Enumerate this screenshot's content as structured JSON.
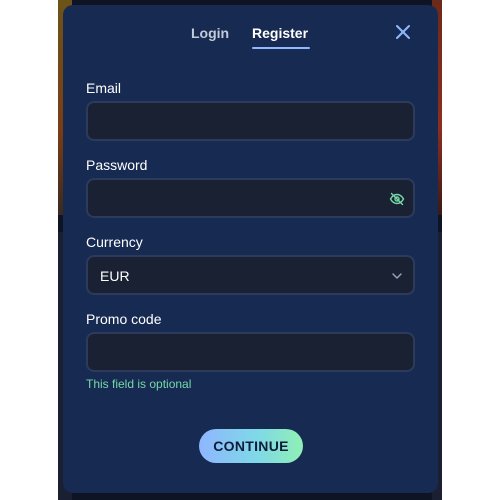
{
  "tabs": {
    "login": "Login",
    "register": "Register",
    "active": "register"
  },
  "fields": {
    "email_label": "Email",
    "email_value": "",
    "password_label": "Password",
    "password_value": "",
    "currency_label": "Currency",
    "currency_value": "EUR",
    "promo_label": "Promo code",
    "promo_value": "",
    "promo_hint": "This field is optional"
  },
  "actions": {
    "continue_label": "CONTINUE"
  },
  "icons": {
    "close": "close-icon",
    "password_toggle": "eye-off-icon",
    "currency_dropdown": "chevron-down-icon"
  },
  "colors": {
    "modal_bg": "#172a52",
    "field_bg": "#1a2133",
    "accent": "#8fb8ff",
    "hint": "#74d9a6",
    "button_gradient": [
      "#8fb6ff",
      "#7fd8e8",
      "#8ff0b4"
    ]
  }
}
